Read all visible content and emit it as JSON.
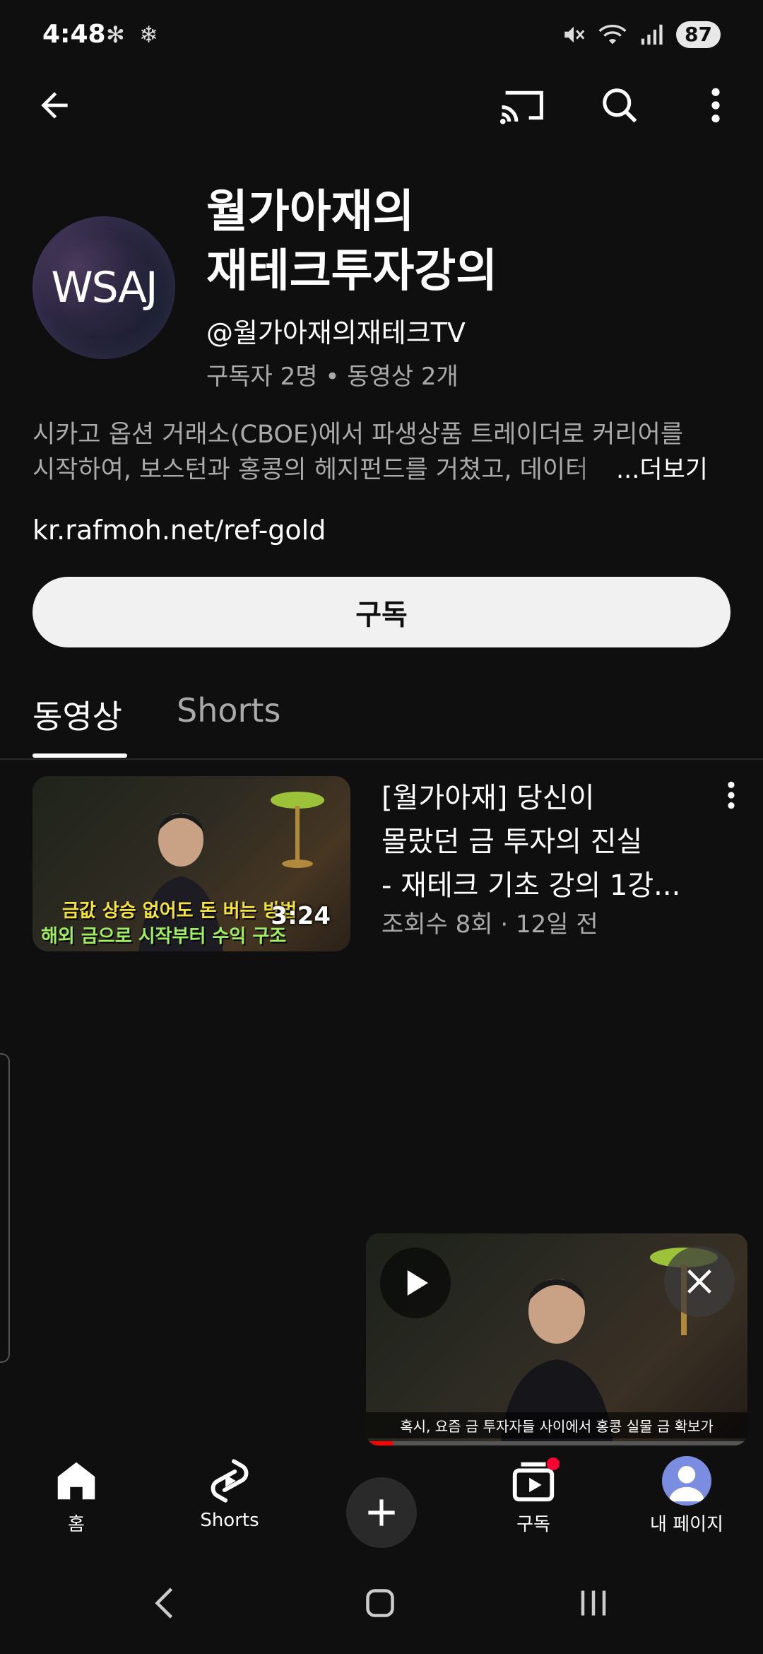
{
  "status_bar": {
    "time": "4:48",
    "battery": "87",
    "left_icons": [
      "fan-icon",
      "snowflake-icon"
    ],
    "right_icons": [
      "mute-icon",
      "wifi-icon",
      "signal-icon"
    ]
  },
  "top_bar": {
    "icons": [
      "back-arrow-icon",
      "cast-icon",
      "search-icon",
      "more-vert-icon"
    ]
  },
  "channel": {
    "avatar_text": "WSAJ",
    "name_line1": "월가아재의",
    "name_line2": "재테크투자강의",
    "handle": "@월가아재의재테크TV",
    "meta": "구독자 2명 • 동영상 2개",
    "description_line1": "시카고 옵션 거래소(CBOE)에서 파생상품 트레이더로 커리어를",
    "description_line2": "시작하여, 보스턴과 홍콩의 헤지펀드를 거쳤고, 데이터",
    "more_label": "...더보기",
    "link": "kr.rafmoh.net/ref-gold",
    "subscribe_label": "구독"
  },
  "tabs": {
    "videos": "동영상",
    "shorts": "Shorts",
    "active": "videos"
  },
  "videos": [
    {
      "title_line1": "[월가아재] 당신이",
      "title_line2": "몰랐던 금 투자의 진실",
      "title_line3": "- 재테크 기초 강의 1강...",
      "meta": "조회수 8회 · 12일 전",
      "duration": "3:24",
      "thumb_caption1": "금값 상승 없어도 돈 버는 방법",
      "thumb_caption2": "해외 금으로 시작부터 수익 구조"
    }
  ],
  "mini_player": {
    "caption": "혹시, 요즘 금 투자자들 사이에서 홍콩 실물 금 확보가",
    "progress": 0.07
  },
  "bottom_nav": {
    "home": "홈",
    "shorts": "Shorts",
    "create_icon": "plus-icon",
    "subscriptions": "구독",
    "you": "내 페이지"
  },
  "colors": {
    "background": "#0f0f0f",
    "accent_red": "#ff0033",
    "secondary_text": "#aaaaaa"
  }
}
